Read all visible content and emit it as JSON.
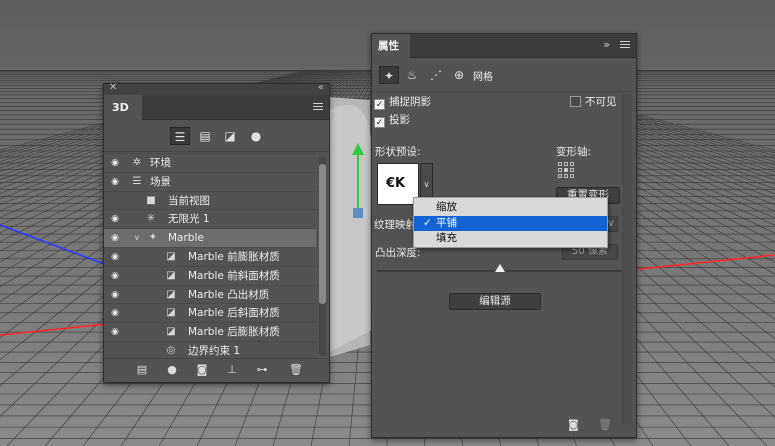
{
  "colors": {
    "panel_bg": "#535353",
    "menu_bg": "#d9d9d9",
    "menu_selected": "#1462d3",
    "axis_red": "#ff2a2a",
    "axis_blue": "#2a3cff",
    "gizmo_green": "#2ecc40"
  },
  "panel_3d": {
    "title": "3D",
    "filter_icons": [
      "scene-filter-icon",
      "mesh-filter-icon",
      "material-filter-icon",
      "light-filter-icon"
    ],
    "layers": [
      {
        "label": "环境",
        "icon": "environment-icon"
      },
      {
        "label": "场景",
        "icon": "scene-icon"
      },
      {
        "label": "当前视图",
        "icon": "camera-icon"
      },
      {
        "label": "无限光 1",
        "icon": "infinite-light-icon"
      },
      {
        "label": "Marble",
        "icon": "mesh-icon"
      },
      {
        "label": "Marble 前膨胀材质",
        "icon": "material-icon"
      },
      {
        "label": "Marble 前斜面材质",
        "icon": "material-icon"
      },
      {
        "label": "Marble 凸出材质",
        "icon": "material-icon"
      },
      {
        "label": "Marble 后斜面材质",
        "icon": "material-icon"
      },
      {
        "label": "Marble 后膨胀材质",
        "icon": "material-icon"
      },
      {
        "label": "边界约束 1",
        "icon": "constraint-icon"
      }
    ],
    "selected_layer": "Marble"
  },
  "properties": {
    "title": "属性",
    "tab_icons": [
      "mesh-tab-icon",
      "deform-tab-icon",
      "cap-tab-icon",
      "coordinates-tab-icon"
    ],
    "mesh_label": "网格",
    "catch_shadows": "捕捉阴影",
    "cast_shadows": "投影",
    "invisible": "不可见",
    "shape_preset": "形状预设:",
    "preset_preview": "€K",
    "deform_axis": "变形轴:",
    "reset_deform": "重置变形",
    "texture_mapping": "纹理映射:",
    "extrusion_depth": "凸出深度:",
    "depth_value": "50 像素",
    "edit_source": "编辑源"
  },
  "mapping_menu": {
    "options": [
      "缩放",
      "平铺",
      "填充"
    ],
    "selected": "平铺",
    "check": "✓"
  }
}
